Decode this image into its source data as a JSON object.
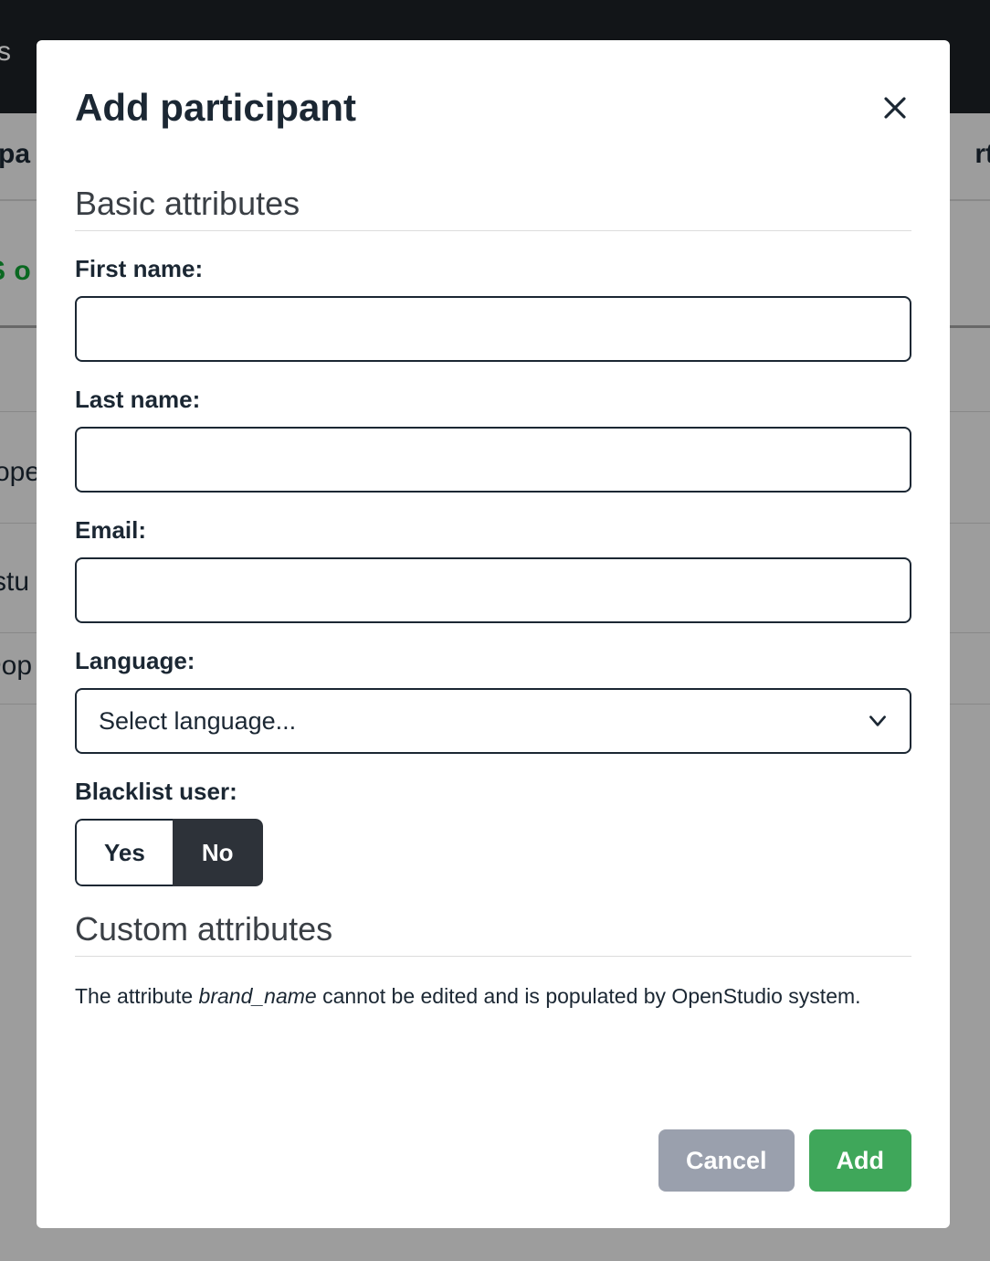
{
  "background": {
    "topbar_fragment": "ys",
    "left_fragment_1": "pa",
    "right_fragment_1": "rtic",
    "green_fragment": "S o",
    "left_fragment_2": "ope",
    "left_fragment_3": "stu",
    "left_fragment_4": "Dop"
  },
  "modal": {
    "title": "Add participant",
    "sections": {
      "basic": {
        "heading": "Basic attributes",
        "first_name": {
          "label": "First name:",
          "value": ""
        },
        "last_name": {
          "label": "Last name:",
          "value": ""
        },
        "email": {
          "label": "Email:",
          "value": ""
        },
        "language": {
          "label": "Language:",
          "placeholder": "Select language..."
        },
        "blacklist": {
          "label": "Blacklist user:",
          "yes": "Yes",
          "no": "No",
          "selected": "No"
        }
      },
      "custom": {
        "heading": "Custom attributes",
        "note_prefix": "The attribute ",
        "note_attr": "brand_name",
        "note_suffix": " cannot be edited and is populated by OpenStudio system."
      }
    },
    "footer": {
      "cancel": "Cancel",
      "add": "Add"
    }
  }
}
